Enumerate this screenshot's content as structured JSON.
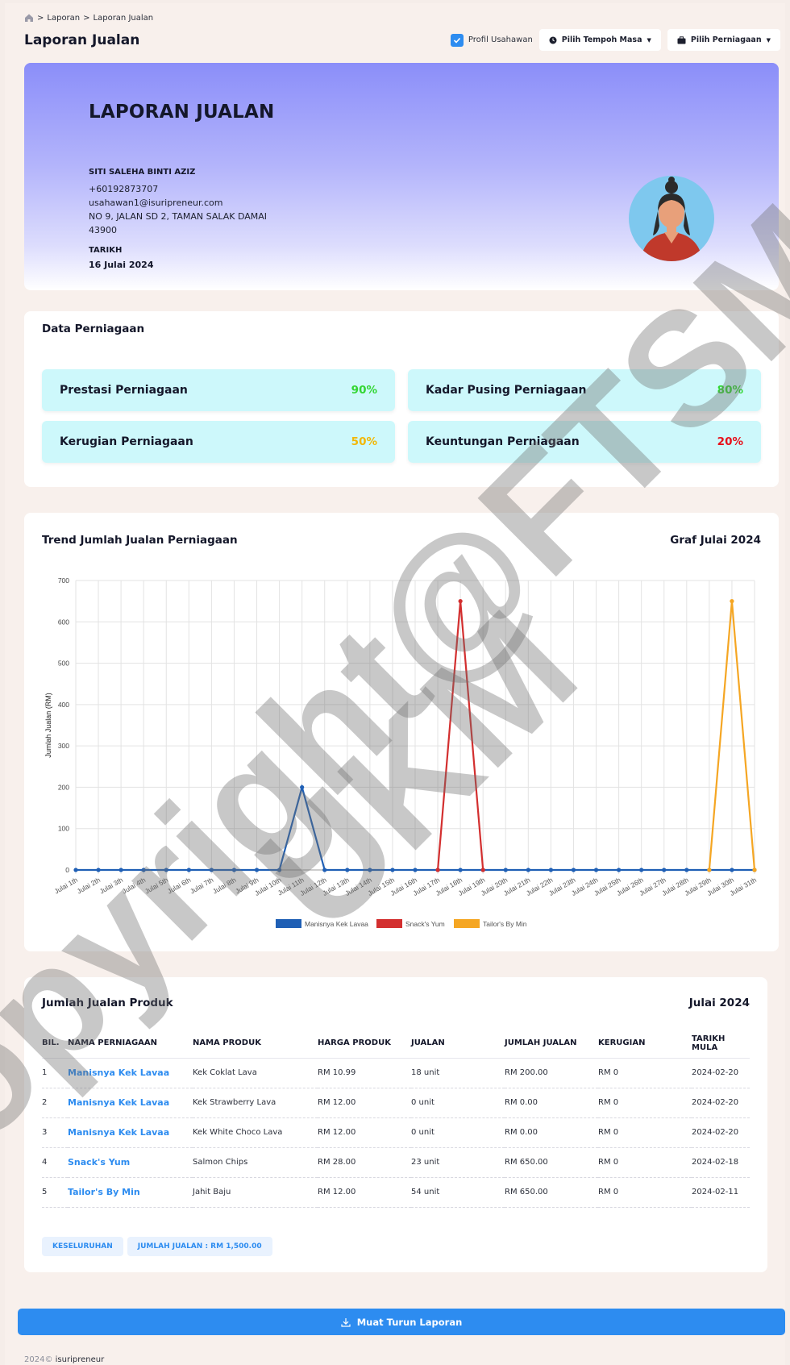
{
  "breadcrumb": {
    "home_icon": "home-icon",
    "items": [
      "Laporan",
      "Laporan Jualan"
    ],
    "separator": ">"
  },
  "page_title": "Laporan Jualan",
  "toolbar": {
    "profile_label": "Profil Usahawan",
    "profile_checked": true,
    "period_button": "Pilih Tempoh Masa",
    "business_button": "Pilih Perniagaan"
  },
  "hero": {
    "title": "LAPORAN JUALAN",
    "name": "SITI SALEHA BINTI AZIZ",
    "phone": "+60192873707",
    "email": "usahawan1@isuripreneur.com",
    "address": "NO 9, JALAN SD 2, TAMAN SALAK DAMAI",
    "postcode": "43900",
    "date_label": "TARIKH",
    "date": "16 Julai 2024"
  },
  "business": {
    "title": "Data Perniagaan",
    "stats": [
      {
        "label": "Prestasi Perniagaan",
        "value": "90%",
        "color": "#33d633"
      },
      {
        "label": "Kadar Pusing Perniagaan",
        "value": "80%",
        "color": "#33d633"
      },
      {
        "label": "Kerugian Perniagaan",
        "value": "50%",
        "color": "#f2b705"
      },
      {
        "label": "Keuntungan Perniagaan",
        "value": "20%",
        "color": "#e8101a"
      }
    ]
  },
  "chart_section": {
    "title": "Trend Jumlah Jualan Perniagaan",
    "period": "Graf Julai 2024"
  },
  "chart_data": {
    "type": "line",
    "ylabel": "Jumlah Jualan (RM)",
    "ylim": [
      0,
      700
    ],
    "yticks": [
      0,
      100,
      200,
      300,
      400,
      500,
      600,
      700
    ],
    "grid": true,
    "legend_position": "bottom",
    "categories": [
      "Julai 1th",
      "Julai 2th",
      "Julai 3th",
      "Julai 4th",
      "Julai 5th",
      "Julai 6th",
      "Julai 7th",
      "Julai 8th",
      "Julai 9th",
      "Julai 10th",
      "Julai 11th",
      "Julai 12th",
      "Julai 13th",
      "Julai 14th",
      "Julai 15th",
      "Julai 16th",
      "Julai 17th",
      "Julai 18th",
      "Julai 19th",
      "Julai 20th",
      "Julai 21th",
      "Julai 22th",
      "Julai 23th",
      "Julai 24th",
      "Julai 25th",
      "Julai 26th",
      "Julai 27th",
      "Julai 28th",
      "Julai 29th",
      "Julai 30th",
      "Julai 31th"
    ],
    "series": [
      {
        "name": "Manisnya Kek Lavaa",
        "color": "#1f5fb5",
        "values": [
          0,
          0,
          0,
          0,
          0,
          0,
          0,
          0,
          0,
          0,
          200,
          0,
          0,
          0,
          0,
          0,
          0,
          0,
          0,
          0,
          0,
          0,
          0,
          0,
          0,
          0,
          0,
          0,
          0,
          0,
          0
        ]
      },
      {
        "name": "Snack's Yum",
        "color": "#d32f2f",
        "values": [
          null,
          null,
          null,
          null,
          null,
          null,
          null,
          null,
          null,
          null,
          null,
          null,
          null,
          null,
          null,
          null,
          0,
          650,
          0,
          null,
          null,
          null,
          null,
          null,
          null,
          null,
          null,
          null,
          null,
          null,
          null
        ]
      },
      {
        "name": "Tailor's By Min",
        "color": "#f5a623",
        "values": [
          null,
          null,
          null,
          null,
          null,
          null,
          null,
          null,
          null,
          null,
          null,
          null,
          null,
          null,
          null,
          null,
          null,
          null,
          null,
          null,
          null,
          null,
          null,
          null,
          null,
          null,
          null,
          null,
          0,
          650,
          0
        ]
      }
    ]
  },
  "table_section": {
    "title": "Jumlah Jualan Produk",
    "period": "Julai 2024",
    "columns": [
      "BIL.",
      "NAMA PERNIAGAAN",
      "NAMA PRODUK",
      "HARGA PRODUK",
      "JUALAN",
      "JUMLAH JUALAN",
      "KERUGIAN",
      "TARIKH MULA"
    ],
    "rows": [
      [
        "1",
        "Manisnya Kek Lavaa",
        "Kek Coklat Lava",
        "RM 10.99",
        "18 unit",
        "RM 200.00",
        "RM 0",
        "2024-02-20"
      ],
      [
        "2",
        "Manisnya Kek Lavaa",
        "Kek Strawberry Lava",
        "RM 12.00",
        "0 unit",
        "RM 0.00",
        "RM 0",
        "2024-02-20"
      ],
      [
        "3",
        "Manisnya Kek Lavaa",
        "Kek White Choco Lava",
        "RM 12.00",
        "0 unit",
        "RM 0.00",
        "RM 0",
        "2024-02-20"
      ],
      [
        "4",
        "Snack's Yum",
        "Salmon Chips",
        "RM 28.00",
        "23 unit",
        "RM 650.00",
        "RM 0",
        "2024-02-18"
      ],
      [
        "5",
        "Tailor's By Min",
        "Jahit Baju",
        "RM 12.00",
        "54 unit",
        "RM 650.00",
        "RM 0",
        "2024-02-11"
      ]
    ],
    "summary_label": "KESELURUHAN",
    "summary_total": "JUMLAH JUALAN : RM 1,500.00"
  },
  "download_button": "Muat Turun Laporan",
  "footer": {
    "year": "2024©",
    "brand": "isuripreneur"
  },
  "watermark": {
    "line1": "Copyright@FTSM",
    "line2": "UKM"
  },
  "colors": {
    "accent": "#2d8cf0",
    "page_bg": "#f8f0ec",
    "stat_bg": "#cdf8fb"
  }
}
